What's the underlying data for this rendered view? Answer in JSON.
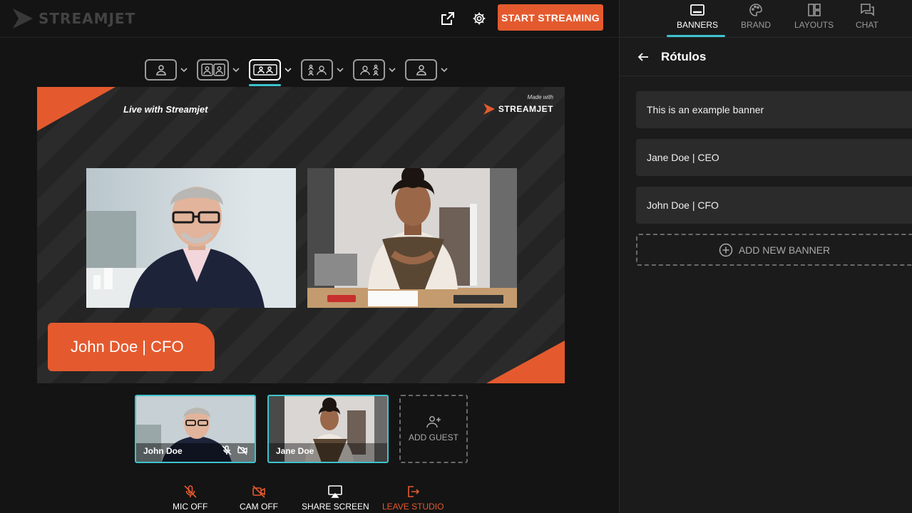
{
  "app": {
    "name": "STREAMJET"
  },
  "topbar": {
    "start_label": "START STREAMING"
  },
  "stage": {
    "title": "Live with Streamjet",
    "made_with": "Made with",
    "made_with_brand": "STREAMJET",
    "active_banner": "John Doe | CFO"
  },
  "participants": [
    {
      "name": "John Doe",
      "mic": "off",
      "cam": "off"
    },
    {
      "name": "Jane Doe"
    }
  ],
  "add_guest_label": "ADD GUEST",
  "controls": {
    "mic": "MIC OFF",
    "cam": "CAM OFF",
    "share": "SHARE SCREEN",
    "leave": "LEAVE STUDIO"
  },
  "panel": {
    "tabs": [
      {
        "label": "BANNERS",
        "icon": "banner-icon",
        "active": true
      },
      {
        "label": "BRAND",
        "icon": "palette-icon"
      },
      {
        "label": "LAYOUTS",
        "icon": "layouts-icon"
      },
      {
        "label": "CHAT",
        "icon": "chat-icon"
      }
    ],
    "title": "Rótulos",
    "banners": [
      "This is an example banner",
      "Jane Doe | CEO",
      "John Doe | CFO"
    ],
    "add_banner_label": "ADD NEW BANNER"
  },
  "colors": {
    "accent": "#e45a2e",
    "highlight": "#3ec3cf"
  }
}
